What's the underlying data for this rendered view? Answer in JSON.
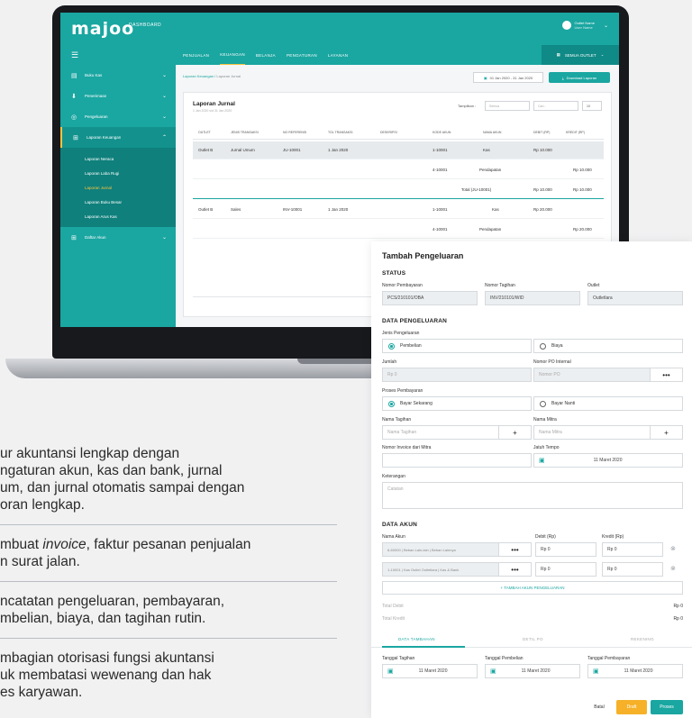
{
  "laptop": {
    "logo": "majoo",
    "logo_sub": "DASHBOARD",
    "user_name": "Outlet Name",
    "user_role": "User Name",
    "outlet_select": "SEMUA OUTLET",
    "nav_tabs": [
      "PENJUALAN",
      "KEUANGAN",
      "BELANJA",
      "PENGATURAN",
      "LAYANAN"
    ],
    "sidebar": {
      "items": [
        "Buku Kas",
        "Penerimaan",
        "Pengeluaran",
        "Laporan Keuangan",
        "Daftar Akun"
      ],
      "sub_items": [
        "Laporan Neraca",
        "Laporan Laba Rugi",
        "Laporan Jurnal",
        "Laporan Buku Besar",
        "Laporan Arus Kas"
      ]
    },
    "breadcrumb": "Laporan Keuangan",
    "breadcrumb_current": "Laporan Jurnal",
    "date_range": "01 Jan 2020 - 31 Jan 2020",
    "download_label": "Download Laporan",
    "card_title": "Laporan Jurnal",
    "card_sub": "1 Jan 2020 s/d 31 Jan 2020",
    "tampilkan_label": "Tampilkan :",
    "filter_placeholder": "Semua",
    "search_placeholder": "Cari...",
    "per_page": "10",
    "table_headers": [
      "OUTLET",
      "JENIS TRANSAKSI",
      "NO REFERENSI",
      "TGL TRANSAKSI",
      "DESKRIPSI",
      "KODE AKUN",
      "NAMA AKUN",
      "DEBIT (RP)",
      "KREDIT (RP)"
    ],
    "rows": [
      {
        "outlet": "Outlet B",
        "jenis": "Jurnal Umum",
        "ref": "JU-10001",
        "tgl": "1 Jan 2020",
        "kode": "1-10001",
        "nama": "Kas",
        "debit": "Rp 10.000",
        "kredit": ""
      },
      {
        "outlet": "",
        "jenis": "",
        "ref": "",
        "tgl": "",
        "kode": "4-10001",
        "nama": "Pendapatan",
        "debit": "",
        "kredit": "Rp 10.000"
      },
      {
        "outlet": "",
        "jenis": "",
        "ref": "",
        "tgl": "",
        "kode": "",
        "nama": "Total (JU-10001)",
        "debit": "Rp 10.000",
        "kredit": "Rp 10.000"
      },
      {
        "outlet": "Outlet B",
        "jenis": "Sales",
        "ref": "INV-10001",
        "tgl": "1 Jan 2020",
        "kode": "1-10001",
        "nama": "Kas",
        "debit": "Rp 20.000",
        "kredit": ""
      },
      {
        "outlet": "",
        "jenis": "",
        "ref": "",
        "tgl": "",
        "kode": "4-10001",
        "nama": "Pendapatan",
        "debit": "",
        "kredit": "Rp 20.000"
      }
    ]
  },
  "features": [
    {
      "lines": [
        "ur akuntansi lengkap dengan",
        "ngaturan akun, kas dan bank, jurnal",
        "um, dan jurnal otomatis sampai dengan",
        "oran lengkap."
      ]
    },
    {
      "pre": "mbuat ",
      "italic": "invoice",
      "post": ", faktur pesanan penjualan",
      "line2": "n surat jalan."
    },
    {
      "lines": [
        "ncatatan pengeluaran, pembayaran,",
        "mbelian, biaya, dan tagihan rutin."
      ]
    },
    {
      "lines": [
        "mbagian otorisasi fungsi akuntansi",
        "uk membatasi wewenang dan hak",
        "es karyawan."
      ]
    }
  ],
  "form": {
    "title": "Tambah Pengeluaran",
    "status_title": "STATUS",
    "nomor_pembayaran_label": "Nomor Pembayaran",
    "nomor_pembayaran_value": "PCS/210101/OBA",
    "nomor_tagihan_label": "Nomor Tagihan",
    "nomor_tagihan_value": "INV/210101/WID",
    "outlet_label": "Outlet",
    "outlet_value": "Outletlara",
    "data_pengeluaran_title": "DATA PENGELUARAN",
    "jenis_label": "Jenis Pengeluaran",
    "jenis_opt1": "Pembelian",
    "jenis_opt2": "Biaya",
    "jumlah_label": "Jumlah",
    "jumlah_placeholder": "Rp 0",
    "po_label": "Nomor PO Internal",
    "po_placeholder": "Nomor PO",
    "proses_label": "Proses Pembayaran",
    "proses_opt1": "Bayar Sekarang",
    "proses_opt2": "Bayar Nanti",
    "tagihan_label": "Nama Tagihan",
    "tagihan_placeholder": "Nama Tagihan",
    "mitra_label": "Nama Mitra",
    "mitra_placeholder": "Nama Mitra",
    "invoice_label": "Nomor Invoice dari Mitra",
    "jatuh_tempo_label": "Jatuh Tempo",
    "jatuh_tempo_value": "11 Maret 2020",
    "keterangan_label": "Keterangan",
    "keterangan_placeholder": "Catatan",
    "data_akun_title": "DATA AKUN",
    "nama_akun_label": "Nama Akun",
    "debit_label": "Debit (Rp)",
    "kredit_label": "Kredit (Rp)",
    "akun_rows": [
      {
        "nama": "6-60000 | Beban Lain-lain | Beban Lainnya",
        "debit": "Rp 0",
        "kredit": "Rp 0"
      },
      {
        "nama": "1-10001 | Kas Outlet Outletlara | Kas & Bank",
        "debit": "Rp 0",
        "kredit": "Rp 0"
      }
    ],
    "add_akun": "+ TAMBAH AKUN PENGELUARAN",
    "total_debit_label": "Total Debit",
    "total_debit_value": "Rp 0",
    "total_kredit_label": "Total Kredit",
    "total_kredit_value": "Rp 0",
    "tabs": [
      "DATA TAMBAHAN",
      "DETIL PO",
      "REKENING"
    ],
    "tgl_tagihan_label": "Tanggal Tagihan",
    "tgl_tagihan_value": "11 Maret 2020",
    "tgl_pembelian_label": "Tanggal Pembelian",
    "tgl_pembelian_value": "11 Maret 2020",
    "tgl_pembayaran_label": "Tanggal Pembayaran",
    "tgl_pembayaran_value": "11 Maret 2020",
    "batal": "Batal",
    "draft": "Draft",
    "proses": "Proses"
  },
  "colors": {
    "teal": "#1aa6a1",
    "orange": "#f6b128",
    "yellow_accent": "#f6c33d"
  }
}
